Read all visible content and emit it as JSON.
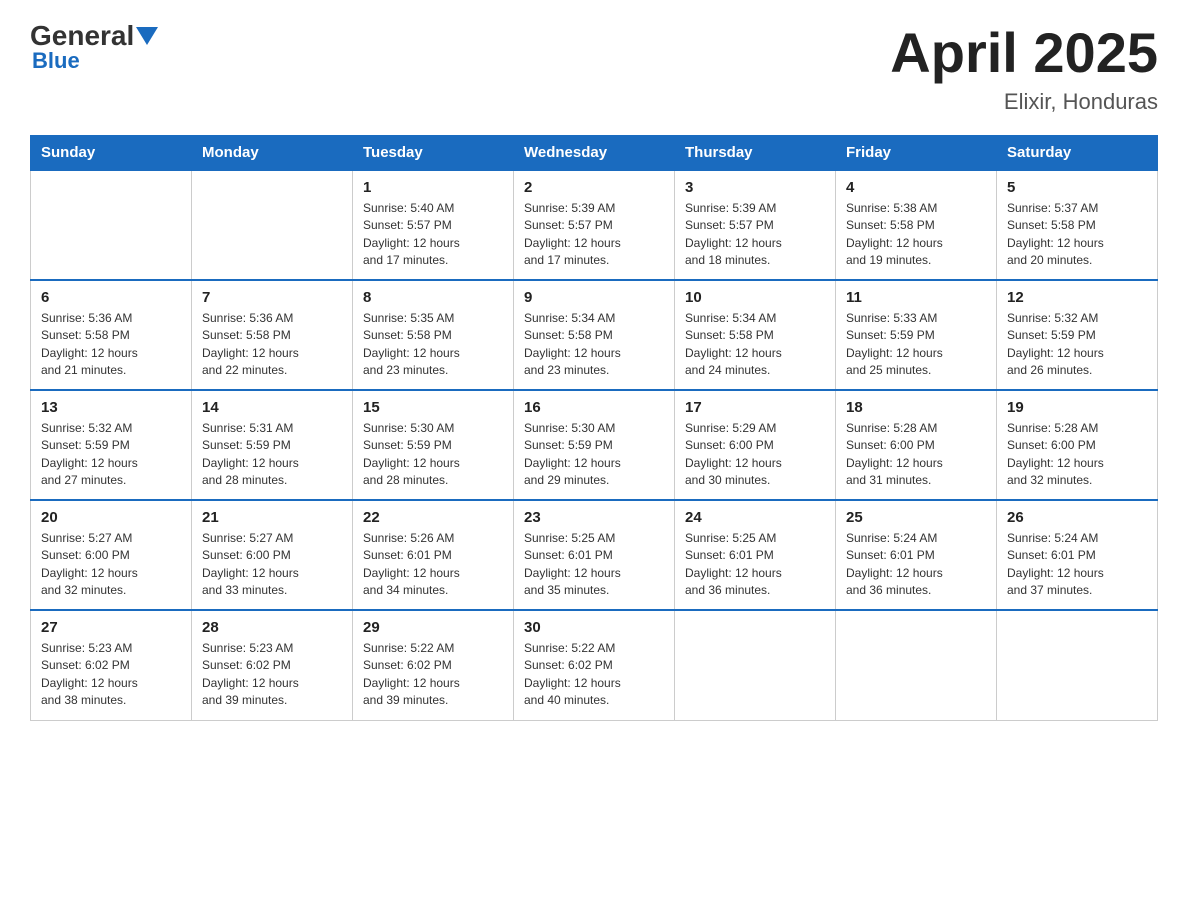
{
  "header": {
    "logo_general": "General",
    "logo_blue": "Blue",
    "month_title": "April 2025",
    "location": "Elixir, Honduras"
  },
  "weekdays": [
    "Sunday",
    "Monday",
    "Tuesday",
    "Wednesday",
    "Thursday",
    "Friday",
    "Saturday"
  ],
  "weeks": [
    [
      {
        "day": "",
        "info": ""
      },
      {
        "day": "",
        "info": ""
      },
      {
        "day": "1",
        "info": "Sunrise: 5:40 AM\nSunset: 5:57 PM\nDaylight: 12 hours\nand 17 minutes."
      },
      {
        "day": "2",
        "info": "Sunrise: 5:39 AM\nSunset: 5:57 PM\nDaylight: 12 hours\nand 17 minutes."
      },
      {
        "day": "3",
        "info": "Sunrise: 5:39 AM\nSunset: 5:57 PM\nDaylight: 12 hours\nand 18 minutes."
      },
      {
        "day": "4",
        "info": "Sunrise: 5:38 AM\nSunset: 5:58 PM\nDaylight: 12 hours\nand 19 minutes."
      },
      {
        "day": "5",
        "info": "Sunrise: 5:37 AM\nSunset: 5:58 PM\nDaylight: 12 hours\nand 20 minutes."
      }
    ],
    [
      {
        "day": "6",
        "info": "Sunrise: 5:36 AM\nSunset: 5:58 PM\nDaylight: 12 hours\nand 21 minutes."
      },
      {
        "day": "7",
        "info": "Sunrise: 5:36 AM\nSunset: 5:58 PM\nDaylight: 12 hours\nand 22 minutes."
      },
      {
        "day": "8",
        "info": "Sunrise: 5:35 AM\nSunset: 5:58 PM\nDaylight: 12 hours\nand 23 minutes."
      },
      {
        "day": "9",
        "info": "Sunrise: 5:34 AM\nSunset: 5:58 PM\nDaylight: 12 hours\nand 23 minutes."
      },
      {
        "day": "10",
        "info": "Sunrise: 5:34 AM\nSunset: 5:58 PM\nDaylight: 12 hours\nand 24 minutes."
      },
      {
        "day": "11",
        "info": "Sunrise: 5:33 AM\nSunset: 5:59 PM\nDaylight: 12 hours\nand 25 minutes."
      },
      {
        "day": "12",
        "info": "Sunrise: 5:32 AM\nSunset: 5:59 PM\nDaylight: 12 hours\nand 26 minutes."
      }
    ],
    [
      {
        "day": "13",
        "info": "Sunrise: 5:32 AM\nSunset: 5:59 PM\nDaylight: 12 hours\nand 27 minutes."
      },
      {
        "day": "14",
        "info": "Sunrise: 5:31 AM\nSunset: 5:59 PM\nDaylight: 12 hours\nand 28 minutes."
      },
      {
        "day": "15",
        "info": "Sunrise: 5:30 AM\nSunset: 5:59 PM\nDaylight: 12 hours\nand 28 minutes."
      },
      {
        "day": "16",
        "info": "Sunrise: 5:30 AM\nSunset: 5:59 PM\nDaylight: 12 hours\nand 29 minutes."
      },
      {
        "day": "17",
        "info": "Sunrise: 5:29 AM\nSunset: 6:00 PM\nDaylight: 12 hours\nand 30 minutes."
      },
      {
        "day": "18",
        "info": "Sunrise: 5:28 AM\nSunset: 6:00 PM\nDaylight: 12 hours\nand 31 minutes."
      },
      {
        "day": "19",
        "info": "Sunrise: 5:28 AM\nSunset: 6:00 PM\nDaylight: 12 hours\nand 32 minutes."
      }
    ],
    [
      {
        "day": "20",
        "info": "Sunrise: 5:27 AM\nSunset: 6:00 PM\nDaylight: 12 hours\nand 32 minutes."
      },
      {
        "day": "21",
        "info": "Sunrise: 5:27 AM\nSunset: 6:00 PM\nDaylight: 12 hours\nand 33 minutes."
      },
      {
        "day": "22",
        "info": "Sunrise: 5:26 AM\nSunset: 6:01 PM\nDaylight: 12 hours\nand 34 minutes."
      },
      {
        "day": "23",
        "info": "Sunrise: 5:25 AM\nSunset: 6:01 PM\nDaylight: 12 hours\nand 35 minutes."
      },
      {
        "day": "24",
        "info": "Sunrise: 5:25 AM\nSunset: 6:01 PM\nDaylight: 12 hours\nand 36 minutes."
      },
      {
        "day": "25",
        "info": "Sunrise: 5:24 AM\nSunset: 6:01 PM\nDaylight: 12 hours\nand 36 minutes."
      },
      {
        "day": "26",
        "info": "Sunrise: 5:24 AM\nSunset: 6:01 PM\nDaylight: 12 hours\nand 37 minutes."
      }
    ],
    [
      {
        "day": "27",
        "info": "Sunrise: 5:23 AM\nSunset: 6:02 PM\nDaylight: 12 hours\nand 38 minutes."
      },
      {
        "day": "28",
        "info": "Sunrise: 5:23 AM\nSunset: 6:02 PM\nDaylight: 12 hours\nand 39 minutes."
      },
      {
        "day": "29",
        "info": "Sunrise: 5:22 AM\nSunset: 6:02 PM\nDaylight: 12 hours\nand 39 minutes."
      },
      {
        "day": "30",
        "info": "Sunrise: 5:22 AM\nSunset: 6:02 PM\nDaylight: 12 hours\nand 40 minutes."
      },
      {
        "day": "",
        "info": ""
      },
      {
        "day": "",
        "info": ""
      },
      {
        "day": "",
        "info": ""
      }
    ]
  ]
}
